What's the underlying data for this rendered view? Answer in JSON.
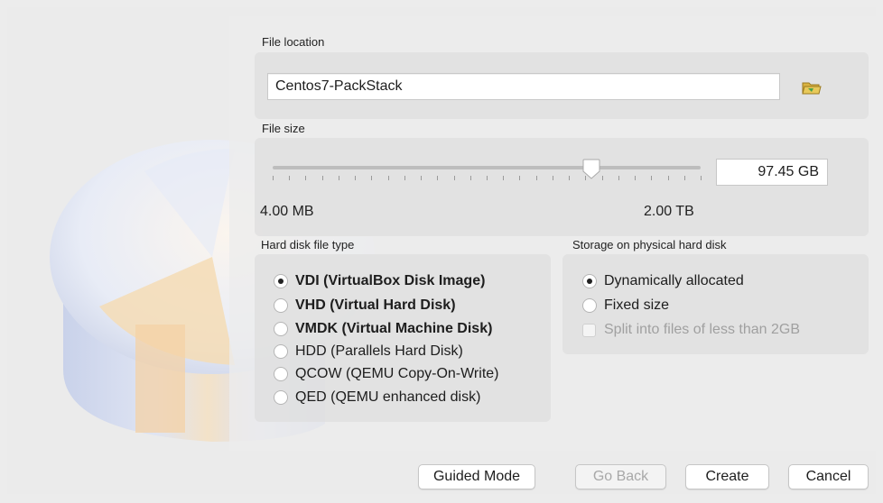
{
  "file_location": {
    "label": "File location",
    "value": "Centos7-PackStack",
    "browse_icon": "folder-icon"
  },
  "file_size": {
    "label": "File size",
    "min_label": "4.00 MB",
    "max_label": "2.00 TB",
    "value": "97.45 GB",
    "slider_fraction": 0.745
  },
  "disk_type": {
    "label": "Hard disk file type",
    "options": [
      {
        "label": "VDI (VirtualBox Disk Image)",
        "selected": true,
        "bold": true
      },
      {
        "label": "VHD (Virtual Hard Disk)",
        "selected": false,
        "bold": true
      },
      {
        "label": "VMDK (Virtual Machine Disk)",
        "selected": false,
        "bold": true
      },
      {
        "label": "HDD (Parallels Hard Disk)",
        "selected": false,
        "bold": false
      },
      {
        "label": "QCOW (QEMU Copy-On-Write)",
        "selected": false,
        "bold": false
      },
      {
        "label": "QED (QEMU enhanced disk)",
        "selected": false,
        "bold": false
      }
    ]
  },
  "storage": {
    "label": "Storage on physical hard disk",
    "options": [
      {
        "label": "Dynamically allocated",
        "selected": true
      },
      {
        "label": "Fixed size",
        "selected": false
      }
    ],
    "split_label": "Split into files of less than 2GB",
    "split_checked": false,
    "split_enabled": false
  },
  "buttons": {
    "guided": "Guided Mode",
    "back": "Go Back",
    "create": "Create",
    "cancel": "Cancel"
  }
}
